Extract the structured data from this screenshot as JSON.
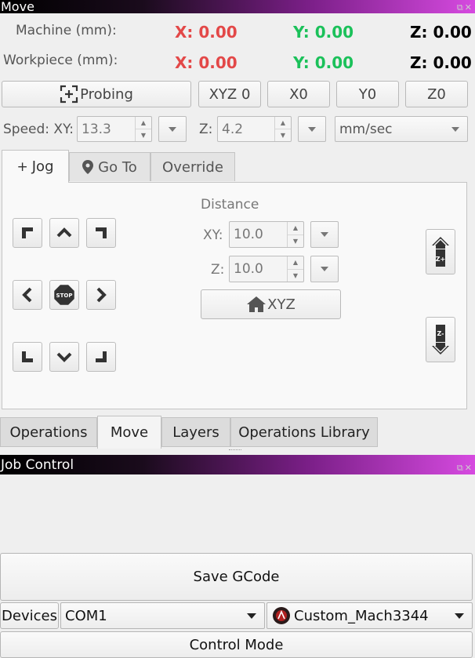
{
  "move_panel": {
    "title": "Move",
    "machine_label": "Machine (mm):",
    "workpiece_label": "Workpiece (mm):",
    "machine": {
      "x": "X: 0.00",
      "y": "Y: 0.00",
      "z": "Z: 0.00"
    },
    "workpiece": {
      "x": "X: 0.00",
      "y": "Y: 0.00",
      "z": "Z: 0.00"
    },
    "buttons": {
      "probing": "Probing",
      "xyz0": "XYZ 0",
      "x0": "X0",
      "y0": "Y0",
      "z0": "Z0"
    },
    "speed": {
      "label_xy": "Speed: XY:",
      "xy_value": "13.3",
      "label_z": "Z:",
      "z_value": "4.2",
      "units": "mm/sec"
    },
    "tabs": [
      {
        "label": "Jog"
      },
      {
        "label": "Go To"
      },
      {
        "label": "Override"
      }
    ],
    "jog": {
      "distance_label": "Distance",
      "xy_label": "XY:",
      "xy_value": "10.0",
      "z_label": "Z:",
      "z_value": "10.0",
      "home_label": "XYZ",
      "stop_text": "STOP",
      "z_up_text": "Z+",
      "z_down_text": "Z-"
    }
  },
  "bottom_tabs": [
    {
      "label": "Operations"
    },
    {
      "label": "Move"
    },
    {
      "label": "Layers"
    },
    {
      "label": "Operations Library"
    }
  ],
  "job_control": {
    "title": "Job Control",
    "save_gcode": "Save GCode",
    "devices_label": "Devices",
    "port": "COM1",
    "profile": "Custom_Mach3344",
    "control_mode": "Control Mode"
  },
  "colors": {
    "x_value": "#e34848",
    "y_value": "#1bc15a",
    "z_value": "#000000",
    "titlebar_start": "#000000",
    "titlebar_end": "#d64ae0"
  }
}
